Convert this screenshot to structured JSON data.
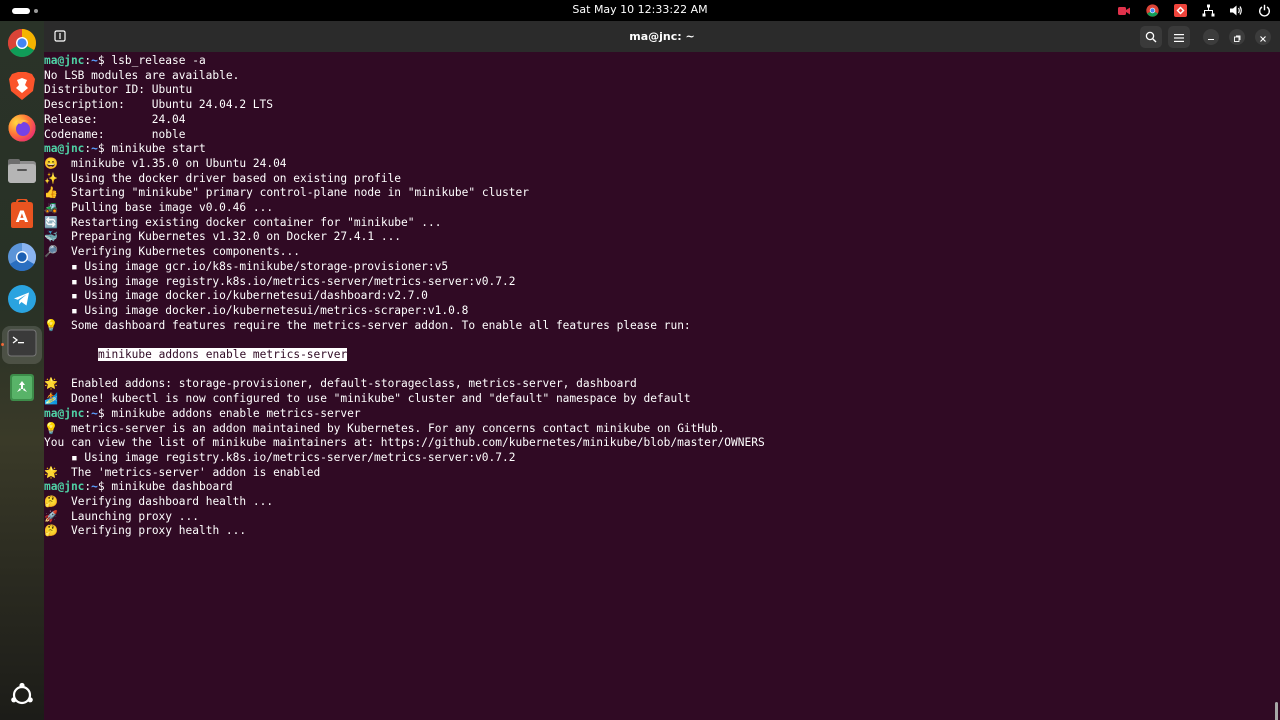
{
  "topbar": {
    "clock": "Sat May 10  12:33:22 AM"
  },
  "dock": {
    "items": [
      {
        "name": "chrome-icon"
      },
      {
        "name": "brave-icon"
      },
      {
        "name": "firefox-icon"
      },
      {
        "name": "files-icon"
      },
      {
        "name": "app-center-icon"
      },
      {
        "name": "chromium-icon"
      },
      {
        "name": "telegram-icon"
      },
      {
        "name": "terminal-icon"
      },
      {
        "name": "trash-icon"
      },
      {
        "name": "show-apps-icon"
      }
    ]
  },
  "window": {
    "title": "ma@jnc: ~"
  },
  "prompt": {
    "user": "ma@jnc",
    "sep": ":",
    "path": "~",
    "symbol": "$ "
  },
  "terminal": {
    "cmd1": "lsb_release -a",
    "out1": "No LSB modules are available.",
    "out2": "Distributor ID: Ubuntu",
    "out3": "Description:    Ubuntu 24.04.2 LTS",
    "out4": "Release:        24.04",
    "out5": "Codename:       noble",
    "cmd2": "minikube start",
    "e1": "😄",
    "s1": "minikube v1.35.0 on Ubuntu 24.04",
    "e2": "✨",
    "s2": "Using the docker driver based on existing profile",
    "e3": "👍",
    "s3": "Starting \"minikube\" primary control-plane node in \"minikube\" cluster",
    "e4": "🚜",
    "s4": "Pulling base image v0.0.46 ...",
    "e5": "🔄",
    "s5": "Restarting existing docker container for \"minikube\" ...",
    "e6": "🐳",
    "s6": "Preparing Kubernetes v1.32.0 on Docker 27.4.1 ...",
    "e7": "🔎",
    "s7": "Verifying Kubernetes components...",
    "i1": "    ▪ Using image gcr.io/k8s-minikube/storage-provisioner:v5",
    "i2": "    ▪ Using image registry.k8s.io/metrics-server/metrics-server:v0.7.2",
    "i3": "    ▪ Using image docker.io/kubernetesui/dashboard:v2.7.0",
    "i4": "    ▪ Using image docker.io/kubernetesui/metrics-scraper:v1.0.8",
    "e8": "💡",
    "s8": "Some dashboard features require the metrics-server addon. To enable all features please run:",
    "hl": "minikube addons enable metrics-server",
    "e9": "🌟",
    "s9": "Enabled addons: storage-provisioner, default-storageclass, metrics-server, dashboard",
    "e10": "🏄",
    "s10": "Done! kubectl is now configured to use \"minikube\" cluster and \"default\" namespace by default",
    "cmd3": "minikube addons enable metrics-server",
    "e11": "💡",
    "s11": "metrics-server is an addon maintained by Kubernetes. For any concerns contact minikube on GitHub.",
    "out6": "You can view the list of minikube maintainers at: https://github.com/kubernetes/minikube/blob/master/OWNERS",
    "i5": "    ▪ Using image registry.k8s.io/metrics-server/metrics-server:v0.7.2",
    "e12": "🌟",
    "s12": "The 'metrics-server' addon is enabled",
    "cmd4": "minikube dashboard",
    "e13": "🤔",
    "s13": "Verifying dashboard health ...",
    "e14": "🚀",
    "s14": "Launching proxy ...",
    "e15": "🤔",
    "s15": "Verifying proxy health ..."
  }
}
